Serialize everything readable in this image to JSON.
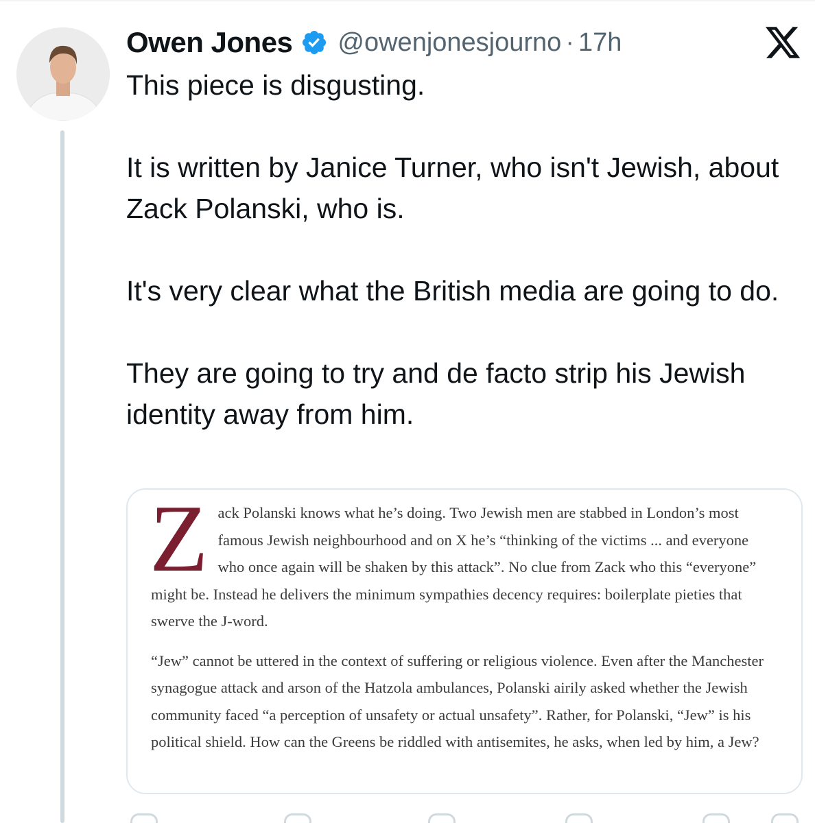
{
  "author": {
    "name": "Owen Jones",
    "handle": "@owenjonesjourno",
    "separator": "·",
    "time": "17h",
    "verified": true,
    "verified_color": "#1d9bf0"
  },
  "tweet": {
    "paragraphs": [
      "This piece is disgusting.",
      "It is written by Janice Turner, who isn't Jewish, about Zack Polanski, who is.",
      "It's very clear what the British media are going to do.",
      "They are going to try and de facto strip his Jewish identity away from him."
    ]
  },
  "article_image": {
    "drop_cap": "Z",
    "drop_cap_color": "#7a1e30",
    "paragraph1_rest": "ack Polanski knows what he’s doing. Two Jewish men are stabbed in London’s most famous Jewish neighbourhood and on X he’s “thinking of the victims ... and everyone who once again will be shaken by this attack”. No clue from Zack who this “everyone” might be. Instead he delivers the minimum sympathies decency requires: boilerplate pieties that swerve the J-word.",
    "paragraph2": "“Jew” cannot be uttered in the context of suffering or religious violence. Even after the Manchester synagogue attack and arson of the Hatzola ambulances, Polanski airily asked whether the Jewish community faced “a perception of unsafety or actual unsafety”. Rather, for Polanski, “Jew” is his political shield. How can the Greens be riddled with antisemites, he asks, when led by him, a Jew?"
  },
  "icons": {
    "avatar": "profile-photo",
    "verified": "verified-badge-icon",
    "platform": "x-logo-icon"
  }
}
